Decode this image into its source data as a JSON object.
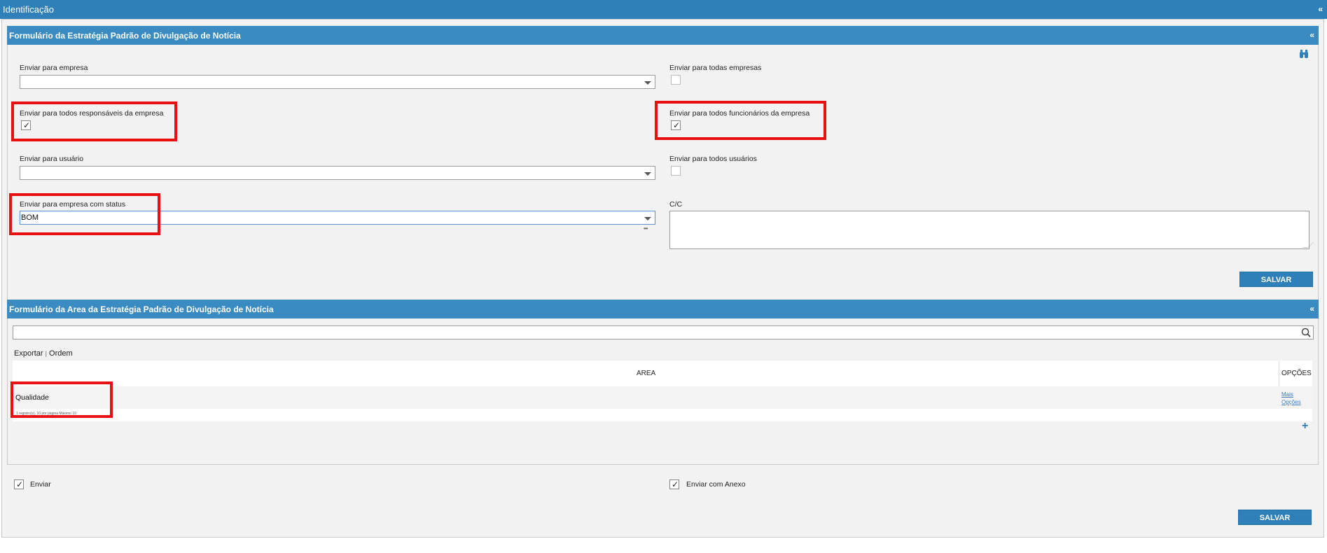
{
  "header": {
    "title": "Identificação",
    "collapse": "«"
  },
  "form1": {
    "title": "Formulário da Estratégia Padrão de Divulgação de Notícia",
    "collapse": "«",
    "send_company_label": "Enviar para empresa",
    "send_company_value": "",
    "send_all_companies_label": "Enviar para todas empresas",
    "send_all_companies_checked": false,
    "send_all_managers_label": "Enviar para todos responsáveis da empresa",
    "send_all_managers_checked": true,
    "send_all_employees_label": "Enviar para todos funcionários da empresa",
    "send_all_employees_checked": true,
    "send_user_label": "Enviar para usuário",
    "send_user_value": "",
    "send_all_users_label": "Enviar para todos usuários",
    "send_all_users_checked": false,
    "send_status_label": "Enviar para empresa com status",
    "send_status_value": "BOM",
    "cc_label": "C/C",
    "cc_value": "",
    "more_dots": "•••",
    "save_label": "SALVAR",
    "check_mark": "✓"
  },
  "form2": {
    "title": "Formulário da Area da Estratégia Padrão de Divulgação de Notícia",
    "collapse": "«",
    "search_placeholder": "",
    "export_label": "Exportar",
    "separator": "|",
    "order_label": "Ordem",
    "columns": {
      "area": "AREA",
      "options": "OPÇÕES"
    },
    "rows": [
      {
        "area": "Qualidade",
        "options_line1": "Mais",
        "options_line2": "Opções"
      }
    ],
    "footer_info": "1 registro(s), 10 por página Máximo 10",
    "add_icon": "+"
  },
  "bottom": {
    "send_label": "Enviar",
    "send_checked": true,
    "send_attach_label": "Enviar com Anexo",
    "send_attach_checked": true,
    "save_label": "SALVAR",
    "check_mark": "✓"
  },
  "colors": {
    "header_blue": "#2f80b8",
    "highlight_red": "#e81010"
  }
}
